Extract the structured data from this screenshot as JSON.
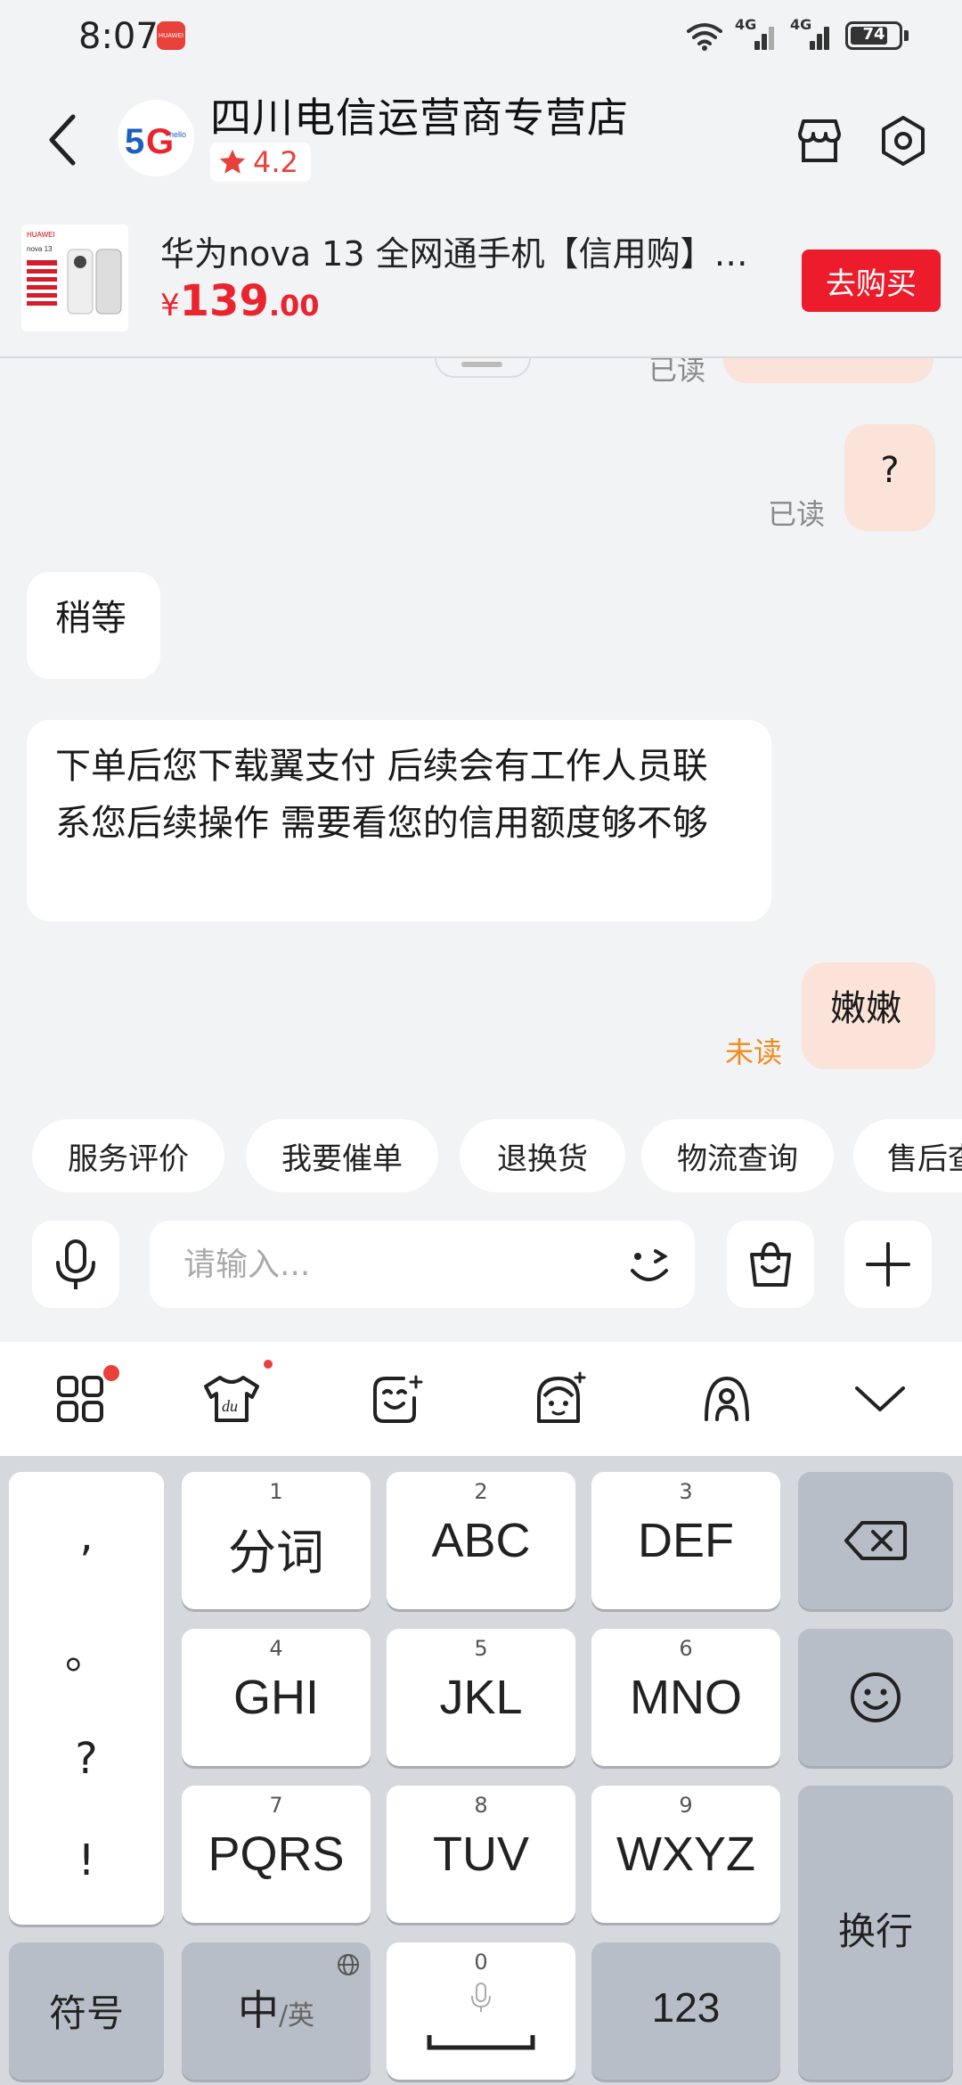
{
  "status": {
    "time": "8:07",
    "network1": "4G",
    "network2": "4G",
    "battery": "74",
    "notification_label": "HUAWEI"
  },
  "header": {
    "shop_name": "四川电信运营商专营店",
    "rating": "4.2",
    "logo_text": "5G",
    "logo_small": "hello"
  },
  "product": {
    "title": "华为nova 13 全网通手机【信用购】…",
    "price_currency": "¥",
    "price_int": "139",
    "price_dec": ".00",
    "buy_label": "去购买",
    "thumb_brand": "HUAWEI",
    "thumb_model": "nova 13"
  },
  "chat": {
    "top_read": "已读",
    "msg_q": "?",
    "msg_q_status": "已读",
    "msg_wait": "稍等",
    "msg_long": "下单后您下载翼支付 后续会有工作人员联系您后续操作 需要看您的信用额度够不够",
    "msg_nennen": "嫩嫩",
    "msg_nennen_status": "未读"
  },
  "chips": [
    "服务评价",
    "我要催单",
    "退换货",
    "物流查询",
    "售后查"
  ],
  "input": {
    "placeholder": "请输入..."
  },
  "keyboard": {
    "punct": [
      ",",
      "。",
      "?",
      "!"
    ],
    "keys": [
      {
        "num": "1",
        "label": "分词"
      },
      {
        "num": "2",
        "label": "ABC"
      },
      {
        "num": "3",
        "label": "DEF"
      },
      {
        "num": "4",
        "label": "GHI"
      },
      {
        "num": "5",
        "label": "JKL"
      },
      {
        "num": "6",
        "label": "MNO"
      },
      {
        "num": "7",
        "label": "PQRS"
      },
      {
        "num": "8",
        "label": "TUV"
      },
      {
        "num": "9",
        "label": "WXYZ"
      }
    ],
    "symbol": "符号",
    "lang_main": "中",
    "lang_sub": "/英",
    "space_num": "0",
    "numbers": "123",
    "enter": "换行"
  },
  "colors": {
    "accent": "#ec1c2c",
    "my_bubble": "#fbe3d9",
    "unread": "#f08c1e"
  }
}
